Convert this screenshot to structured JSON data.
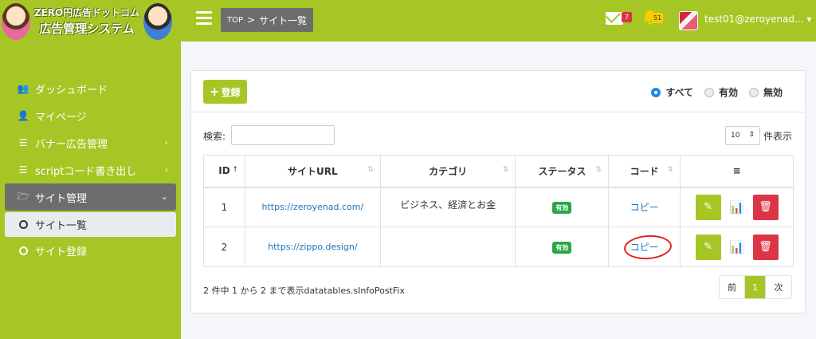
{
  "brand": {
    "line1": "ZERO円広告ドットコム",
    "line2": "広告管理システム"
  },
  "nav": {
    "items": [
      {
        "label": "ダッシュボード",
        "icon": "users-icon"
      },
      {
        "label": "マイページ",
        "icon": "user-icon"
      },
      {
        "label": "バナー広告管理",
        "icon": "layers-icon"
      },
      {
        "label": "scriptコード書き出し",
        "icon": "layers-icon"
      },
      {
        "label": "サイト管理",
        "icon": "folder-icon"
      },
      {
        "label": "サイト一覧",
        "icon": "circle-icon"
      },
      {
        "label": "サイト登録",
        "icon": "circle-icon"
      }
    ]
  },
  "header": {
    "breadcrumb_top": "TOP",
    "breadcrumb_sep": ">",
    "breadcrumb_current": "サイト一覧",
    "mail_count": "7",
    "notif_count": "51",
    "user": "test01@zeroyenad..."
  },
  "toolbar": {
    "add_label": "登録",
    "filters": [
      "すべて",
      "有効",
      "無効"
    ],
    "selected_filter": "すべて"
  },
  "table_controls": {
    "search_label": "検索:",
    "search_value": "",
    "page_length": "10",
    "page_length_label": "件表示"
  },
  "table": {
    "columns": [
      "ID",
      "サイトURL",
      "カテゴリ",
      "ステータス",
      "コード",
      "≡"
    ],
    "rows": [
      {
        "id": "1",
        "url": "https://zeroyenad.com/",
        "category": "ビジネス、経済とお金",
        "status": "有効",
        "code": "コピー"
      },
      {
        "id": "2",
        "url": "https://zippo.design/",
        "category": "",
        "status": "有効",
        "code": "コピー"
      }
    ]
  },
  "footer": {
    "info": "2 件中 1 から 2 まで表示datatables.sInfoPostFix",
    "prev": "前",
    "page": "1",
    "next": "次"
  },
  "colors": {
    "accent": "#a6c625",
    "danger": "#dc3545",
    "success": "#28a745",
    "link": "#1e73be",
    "annotation": "#e02020"
  }
}
